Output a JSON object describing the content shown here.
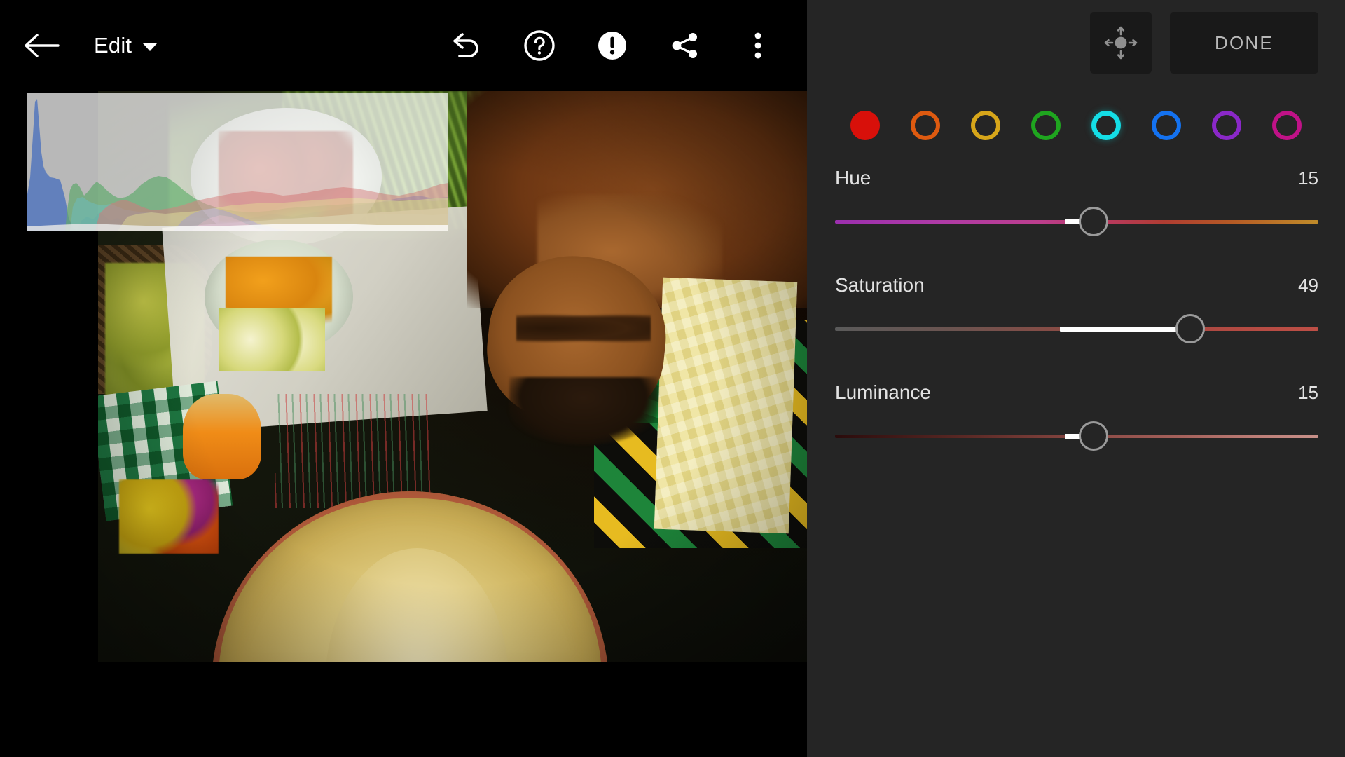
{
  "app": {
    "bg_color": "#000000",
    "panel_color": "#252525"
  },
  "toolbar": {
    "back_icon": "arrow-left-icon",
    "mode_label": "Edit",
    "mode_caret_icon": "chevron-down-icon",
    "actions": [
      {
        "name": "undo-icon",
        "label": "Undo"
      },
      {
        "name": "help-icon",
        "label": "Help"
      },
      {
        "name": "info-icon",
        "label": "Info"
      },
      {
        "name": "share-icon",
        "label": "Share"
      },
      {
        "name": "overflow-menu-icon",
        "label": "More options"
      }
    ]
  },
  "canvas": {
    "histogram": {
      "visible": true,
      "channels": [
        "red",
        "green",
        "blue",
        "luminance"
      ]
    }
  },
  "panel": {
    "targeted_adjustment_icon": "targeted-adjustment-icon",
    "done_label": "DONE",
    "swatches": [
      {
        "name": "red",
        "color": "#D8100A",
        "selected": true,
        "hover": false
      },
      {
        "name": "orange",
        "color": "#DE5A10",
        "selected": false,
        "hover": false
      },
      {
        "name": "yellow",
        "color": "#D7A61A",
        "selected": false,
        "hover": false
      },
      {
        "name": "green",
        "color": "#1FA51F",
        "selected": false,
        "hover": false
      },
      {
        "name": "aqua",
        "color": "#14DEE6",
        "selected": false,
        "hover": true
      },
      {
        "name": "blue",
        "color": "#1472F0",
        "selected": false,
        "hover": false
      },
      {
        "name": "purple",
        "color": "#8A28C8",
        "selected": false,
        "hover": false
      },
      {
        "name": "magenta",
        "color": "#C01287",
        "selected": false,
        "hover": false
      }
    ],
    "sliders": [
      {
        "name": "Hue",
        "value": "15",
        "percent": 53.5,
        "fill_from": 47.5,
        "gradient": "linear-gradient(90deg,#9B2FAE 0%,#AF3BA6 22%,#BC3E8E 42%,#B8395F 56%,#B03C32 68%,#B55A25 82%,#C08C2A 100%)"
      },
      {
        "name": "Saturation",
        "value": "49",
        "percent": 73.5,
        "fill_from": 46.5,
        "gradient": "linear-gradient(90deg,#5A5A5A 0%,#6B5450 24%,#8A4B44 48%,#A34740 66%,#B24A42 82%,#BE4F46 100%)"
      },
      {
        "name": "Luminance",
        "value": "15",
        "percent": 53.5,
        "fill_from": 47.5,
        "gradient": "linear-gradient(90deg,#2A0B0B 0%,#5C2A26 28%,#8A4843 52%,#A6625C 72%,#BE7F78 88%,#C8918A 100%)"
      }
    ]
  }
}
